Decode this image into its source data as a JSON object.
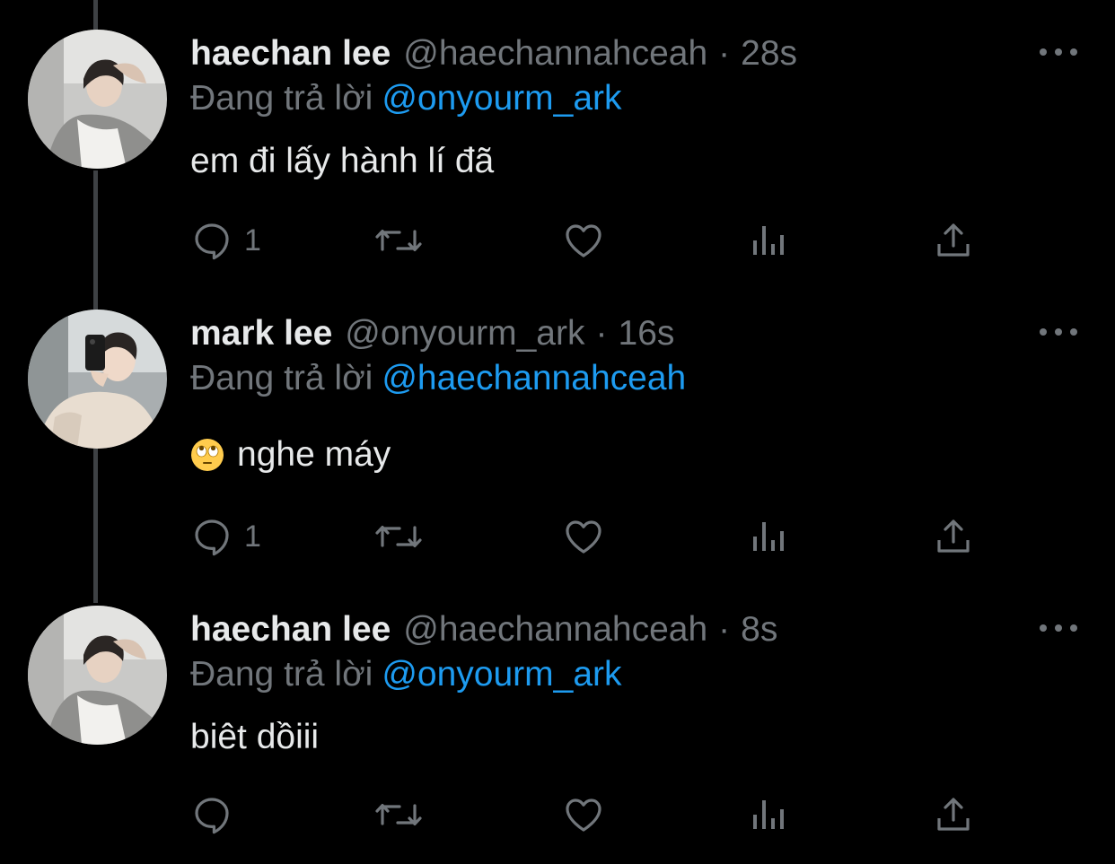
{
  "colors": {
    "background": "#000000",
    "text_primary": "#e7e9ea",
    "text_secondary": "#71767b",
    "link": "#1d9bf0",
    "thread_line": "#3e4144"
  },
  "tweets": [
    {
      "avatar": "avatar-haechan",
      "display_name": "haechan lee",
      "handle": "@haechannahceah",
      "separator": "·",
      "time": "28s",
      "replying_label": "Đang trả lời",
      "replying_to": "@onyourm_ark",
      "text": "em đi lấy hành lí đã",
      "emoji": null,
      "reply_count": "1",
      "icons": [
        "reply-icon",
        "retweet-icon",
        "like-icon",
        "analytics-icon",
        "share-icon",
        "more-icon"
      ]
    },
    {
      "avatar": "avatar-mark",
      "display_name": "mark lee",
      "handle": "@onyourm_ark",
      "separator": "·",
      "time": "16s",
      "replying_label": "Đang trả lời",
      "replying_to": "@haechannahceah",
      "text": "nghe máy",
      "emoji": "face-with-rolling-eyes",
      "reply_count": "1",
      "icons": [
        "reply-icon",
        "retweet-icon",
        "like-icon",
        "analytics-icon",
        "share-icon",
        "more-icon"
      ]
    },
    {
      "avatar": "avatar-haechan",
      "display_name": "haechan lee",
      "handle": "@haechannahceah",
      "separator": "·",
      "time": "8s",
      "replying_label": "Đang trả lời",
      "replying_to": "@onyourm_ark",
      "text": "biêt dồiii",
      "emoji": null,
      "reply_count": "",
      "icons": [
        "reply-icon",
        "retweet-icon",
        "like-icon",
        "analytics-icon",
        "share-icon",
        "more-icon"
      ]
    }
  ]
}
